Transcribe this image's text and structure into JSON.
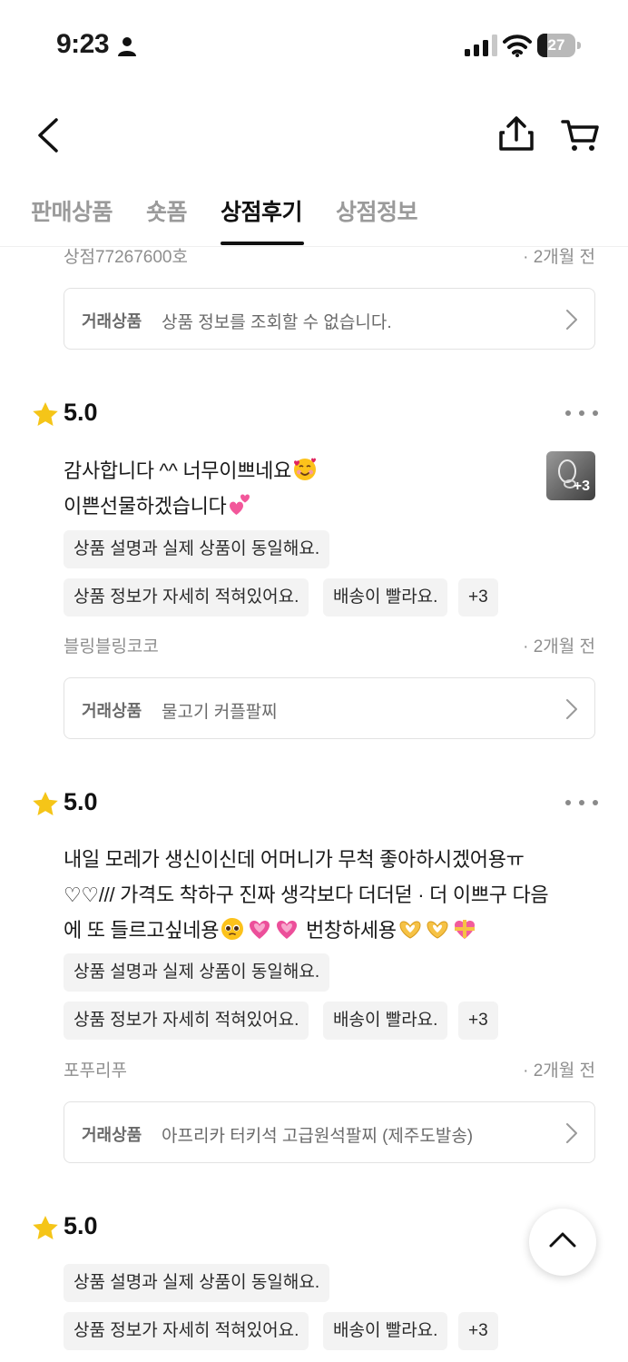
{
  "status_bar": {
    "time": "9:23",
    "battery": "27",
    "battery_level": 0.27
  },
  "nav": {
    "icons": [
      "back-icon",
      "share-icon",
      "cart-icon"
    ]
  },
  "tabs": [
    {
      "label": "판매상품",
      "active": false
    },
    {
      "label": "숏폼",
      "active": false
    },
    {
      "label": "상점후기",
      "active": true
    },
    {
      "label": "상점정보",
      "active": false
    }
  ],
  "partial_review": {
    "author": "상점77267600호",
    "date": "· 2개월 전",
    "product_label": "거래상품",
    "product_name": "상품 정보를 조회할 수 없습니다."
  },
  "reviews": [
    {
      "rating": "5.0",
      "text_lines": [
        "감사합니다 ^^ 너무이쁘네요",
        "이쁜선물하겠습니다"
      ],
      "emojis": [
        "smiling-face-with-hearts",
        "two-hearts"
      ],
      "photo_more": "+3",
      "tags": [
        "상품 설명과 실제 상품이 동일해요.",
        "상품 정보가 자세히 적혀있어요.",
        "배송이 빨라요.",
        "+3"
      ],
      "author": "블링블링코코",
      "date": "· 2개월 전",
      "product_label": "거래상품",
      "product_name": "물고기 커플팔찌"
    },
    {
      "rating": "5.0",
      "text_lines": [
        "내일 모레가 생신이신데 어머니가 무척 좋아하시겠어용ㅠ",
        "♡♡/// 가격도 착하구 진짜 생각보다 더더덛 · 더 이쁘구 다음",
        "에 또 들르고싶네용",
        "번창하세용"
      ],
      "emojis": [
        "pleading-face",
        "growing-heart",
        "growing-heart",
        "heart-hands",
        "heart-hands",
        "heart-with-ribbon"
      ],
      "tags": [
        "상품 설명과 실제 상품이 동일해요.",
        "상품 정보가 자세히 적혀있어요.",
        "배송이 빨라요.",
        "+3"
      ],
      "author": "포푸리푸",
      "date": "· 2개월 전",
      "product_label": "거래상품",
      "product_name": "아프리카 터키석 고급원석팔찌 (제주도발송)"
    },
    {
      "rating": "5.0",
      "tags": [
        "상품 설명과 실제 상품이 동일해요.",
        "상품 정보가 자세히 적혀있어요.",
        "배송이 빨라요.",
        "+3"
      ]
    }
  ],
  "colors": {
    "star": "#f5c518",
    "tab_active": "#111111",
    "tab_inactive": "#9a9a9a",
    "chip_bg": "#f3f3f3"
  }
}
